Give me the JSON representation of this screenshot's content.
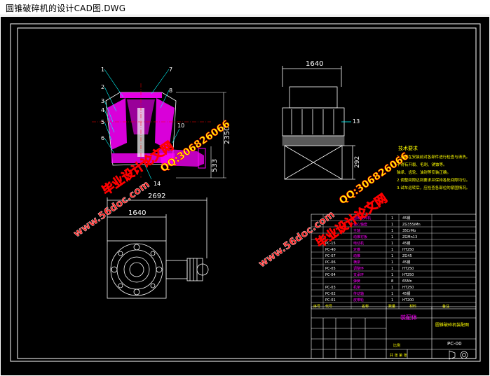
{
  "window": {
    "title": "圆锥破碎机的设计CAD图.DWG"
  },
  "drawing": {
    "background": "#000000",
    "frame_color": "#ffffff",
    "line_color": "#ffffff",
    "dim_color": "#ffffff",
    "magenta": "#ff00ff",
    "leader_color": "#00ffff",
    "part_numbers": [
      "1",
      "2",
      "3",
      "4",
      "5",
      "6",
      "7",
      "8",
      "10",
      "14"
    ],
    "part_number_13": "13",
    "dims": {
      "top_width": "1640",
      "height": "2350",
      "lower": "533",
      "side_height": "292",
      "plan_outer": "2692",
      "plan_inner": "1640"
    },
    "tech_title": "技术要求",
    "tech_notes": [
      "1.机器在安装前对各部件进行检查与清洗。",
      "不得有开裂、毛刺、锈蚀等。",
      "轴承、齿轮、油封等安装正确。",
      "2.调整间隙达到要求并保持各处间隙均匀。",
      "3.试车运转后，应检查各部位的紧固情况。"
    ]
  },
  "bom": {
    "rows": [
      {
        "no": "",
        "name": "圆锥破碎机",
        "qty": "1",
        "mat": "45钢",
        "note": ""
      },
      {
        "no": "",
        "name": "偏心轴套",
        "qty": "1",
        "mat": "ZG35SiMn",
        "note": ""
      },
      {
        "no": "",
        "name": "主轴",
        "qty": "1",
        "mat": "35CrMo",
        "note": ""
      },
      {
        "no": "",
        "name": "动锥衬板",
        "qty": "1",
        "mat": "ZGMn13",
        "note": ""
      },
      {
        "no": "PC-15",
        "name": "电动机",
        "qty": "1",
        "mat": "45钢",
        "note": ""
      },
      {
        "no": "PC-40",
        "name": "定锥",
        "qty": "1",
        "mat": "HT250",
        "note": ""
      },
      {
        "no": "PC-07",
        "name": "动锥",
        "qty": "1",
        "mat": "ZG45",
        "note": ""
      },
      {
        "no": "PC-06",
        "name": "横梁",
        "qty": "1",
        "mat": "45钢",
        "note": ""
      },
      {
        "no": "PC-05",
        "name": "调整环",
        "qty": "1",
        "mat": "HT250",
        "note": ""
      },
      {
        "no": "PC-04",
        "name": "支承环",
        "qty": "1",
        "mat": "HT250",
        "note": ""
      },
      {
        "no": "",
        "name": "弹簧",
        "qty": "8",
        "mat": "65Mn",
        "note": ""
      },
      {
        "no": "PC-03",
        "name": "机架",
        "qty": "1",
        "mat": "HT250",
        "note": ""
      },
      {
        "no": "PC-02",
        "name": "传动轴",
        "qty": "1",
        "mat": "45钢",
        "note": ""
      },
      {
        "no": "PC-01",
        "name": "皮带轮",
        "qty": "1",
        "mat": "HT200",
        "note": ""
      }
    ],
    "header": [
      "序号",
      "代号",
      "名称",
      "数量",
      "材料",
      "备注"
    ]
  },
  "title_block": {
    "assembly": "装配体",
    "drawing_title": "圆锥破碎机装配图",
    "drawing_no": "PC-00",
    "scale_label": "比例",
    "sheet_label": "共 张 第 张"
  },
  "watermarks": {
    "site1": "www.56doc.com",
    "site2": "www.56doc.com",
    "site3": "www.56doc.com",
    "brand1": "毕业设计论文网",
    "brand2": "毕业设计论文网",
    "qq1": "QQ:306826066",
    "qq2": "QQ:306826066",
    "color_cn": "#ffff00",
    "color_url": "#ff2020",
    "color_outline": "#ff0000"
  }
}
